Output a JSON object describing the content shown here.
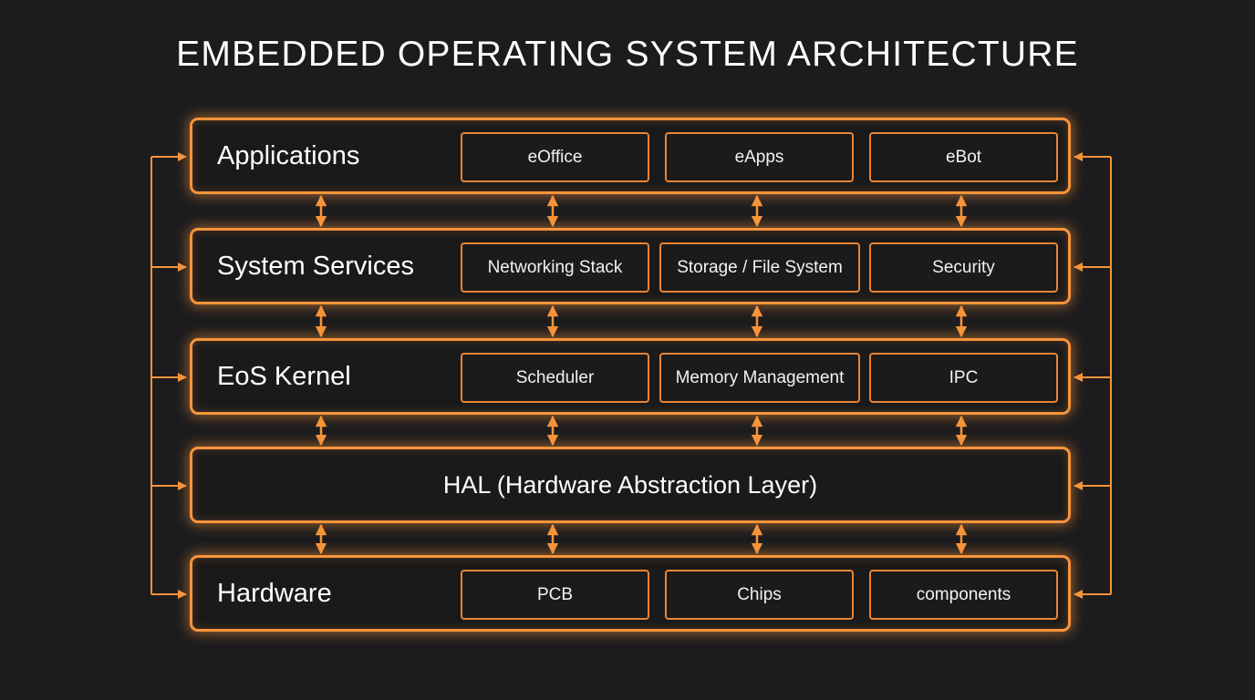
{
  "title": "EMBEDDED OPERATING SYSTEM ARCHITECTURE",
  "colors": {
    "background": "#1c1c1e",
    "accent": "#f7943a",
    "text": "#ffffff"
  },
  "layers": [
    {
      "label": "Applications",
      "components": [
        "eOffice",
        "eApps",
        "eBot"
      ]
    },
    {
      "label": "System Services",
      "components": [
        "Networking Stack",
        "Storage / File System",
        "Security"
      ]
    },
    {
      "label": "EoS Kernel",
      "components": [
        "Scheduler",
        "Memory Management",
        "IPC"
      ]
    },
    {
      "label": "HAL (Hardware Abstraction Layer)",
      "components": []
    },
    {
      "label": "Hardware",
      "components": [
        "PCB",
        "Chips",
        "components"
      ]
    }
  ],
  "connectors": {
    "vertical": "bidirectional-arrows between adjacent layers",
    "side": "left and right feedback lines with arrowheads pointing into each layer"
  }
}
